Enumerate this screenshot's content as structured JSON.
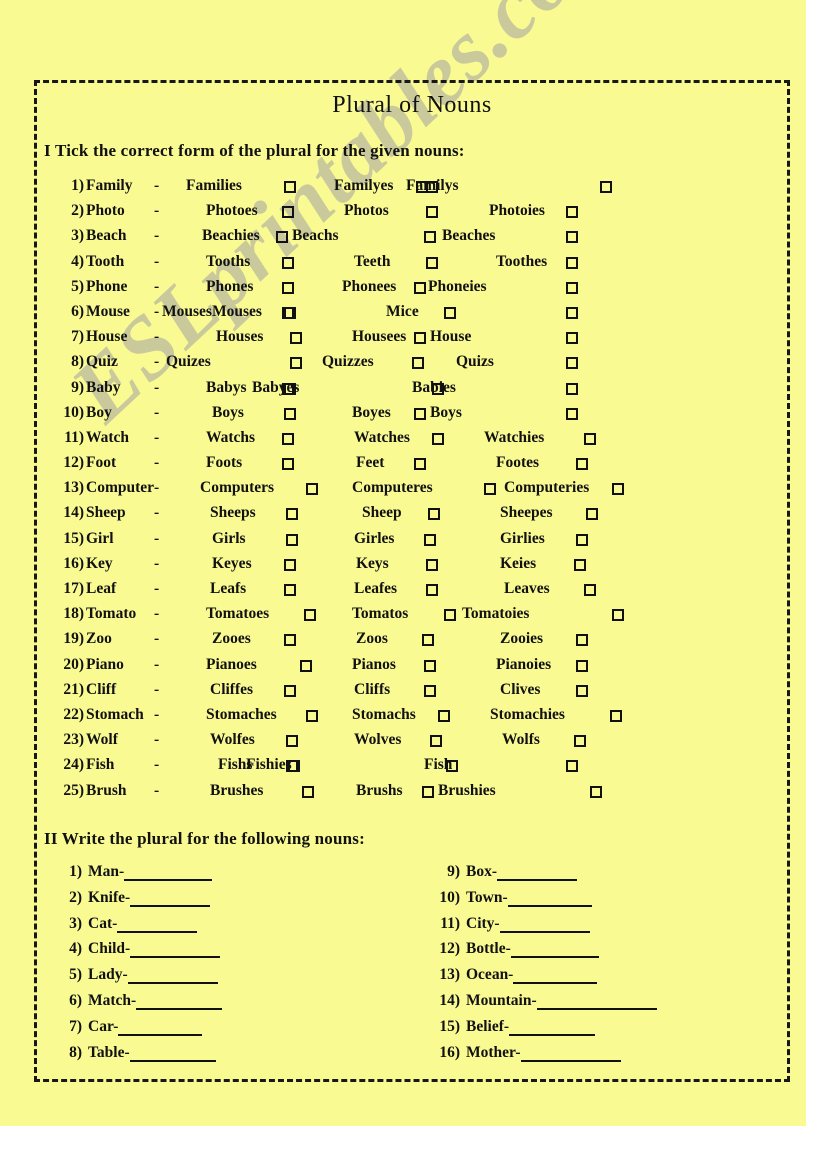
{
  "page": {
    "title": "Plural of Nouns",
    "background_color": "#fafa93",
    "ink_color": "#111111",
    "watermark": "ESLprintables.com",
    "watermark_color": "#c9c99c"
  },
  "section1": {
    "heading": "I Tick the correct form of the plural for the given nouns:",
    "rows": [
      {
        "num": "1)",
        "noun": "Family",
        "dash": "-",
        "opt1": "Families",
        "opt2": "Familyes",
        "opt3": "Familys",
        "opt4": ""
      },
      {
        "num": "2)",
        "noun": "Photo",
        "dash": "-",
        "opt1": "Photoes",
        "opt2": "Photos",
        "opt3": "Photoies",
        "opt4": ""
      },
      {
        "num": "3)",
        "noun": "Beach",
        "dash": "-",
        "opt1": "Beachies",
        "opt2": "Beachs",
        "opt3": "Beaches",
        "opt4": ""
      },
      {
        "num": "4)",
        "noun": "Tooth",
        "dash": "-",
        "opt1": "Tooths",
        "opt2": "Teeth",
        "opt3": "Toothes",
        "opt4": ""
      },
      {
        "num": "5)",
        "noun": "Phone",
        "dash": "-",
        "opt1": "Phones",
        "opt2": "Phonees",
        "opt3": "Phoneies",
        "opt4": ""
      },
      {
        "num": "6)",
        "noun": "Mouse",
        "dash": "-",
        "opt1": "Mouses",
        "opt2": "Mouses",
        "opt3": "Mice",
        "opt4": ""
      },
      {
        "num": "7)",
        "noun": "House",
        "dash": "-",
        "opt1": "Houses",
        "opt2": "Housees",
        "opt3": "House",
        "opt4": ""
      },
      {
        "num": "8)",
        "noun": "Quiz",
        "dash": "-",
        "opt1": "Quizes",
        "opt2": "Quizzes",
        "opt3": "Quizs",
        "opt4": ""
      },
      {
        "num": "9)",
        "noun": "Baby",
        "dash": "-",
        "opt1": "Babys",
        "opt2": "Babyes",
        "opt3": "Babies",
        "opt4": ""
      },
      {
        "num": "10)",
        "noun": "Boy",
        "dash": "-",
        "opt1": "Boys",
        "opt2": "Boyes",
        "opt3": "Boys",
        "opt4": ""
      },
      {
        "num": "11)",
        "noun": "Watch",
        "dash": "-",
        "opt1": "Watchs",
        "opt2": "Watches",
        "opt3": "Watchies",
        "opt4": ""
      },
      {
        "num": "12)",
        "noun": "Foot",
        "dash": "-",
        "opt1": "Foots",
        "opt2": "Feet",
        "opt3": "Footes",
        "opt4": ""
      },
      {
        "num": "13)",
        "noun": "Computer",
        "dash": "-",
        "opt1": "Computers",
        "opt2": "Computeres",
        "opt3": "Computeries",
        "opt4": ""
      },
      {
        "num": "14)",
        "noun": "Sheep",
        "dash": "-",
        "opt1": "Sheeps",
        "opt2": "Sheep",
        "opt3": "Sheepes",
        "opt4": ""
      },
      {
        "num": "15)",
        "noun": "Girl",
        "dash": "-",
        "opt1": "Girls",
        "opt2": "Girles",
        "opt3": "Girlies",
        "opt4": ""
      },
      {
        "num": "16)",
        "noun": "Key",
        "dash": "-",
        "opt1": "Keyes",
        "opt2": "Keys",
        "opt3": "Keies",
        "opt4": ""
      },
      {
        "num": "17)",
        "noun": "Leaf",
        "dash": "-",
        "opt1": "Leafs",
        "opt2": "Leafes",
        "opt3": "Leaves",
        "opt4": ""
      },
      {
        "num": "18)",
        "noun": "Tomato",
        "dash": "-",
        "opt1": "Tomatoes",
        "opt2": "Tomatos",
        "opt3": "Tomatoies",
        "opt4": ""
      },
      {
        "num": "19)",
        "noun": "Zoo",
        "dash": "-",
        "opt1": "Zooes",
        "opt2": "Zoos",
        "opt3": "Zooies",
        "opt4": ""
      },
      {
        "num": "20)",
        "noun": "Piano",
        "dash": "-",
        "opt1": "Pianoes",
        "opt2": "Pianos",
        "opt3": "Pianoies",
        "opt4": ""
      },
      {
        "num": "21)",
        "noun": "Cliff",
        "dash": "-",
        "opt1": "Cliffes",
        "opt2": "Cliffs",
        "opt3": "Clives",
        "opt4": ""
      },
      {
        "num": "22)",
        "noun": "Stomach",
        "dash": "-",
        "opt1": "Stomaches",
        "opt2": "Stomachs",
        "opt3": "Stomachies",
        "opt4": ""
      },
      {
        "num": "23)",
        "noun": "Wolf",
        "dash": "-",
        "opt1": "Wolfes",
        "opt2": "Wolves",
        "opt3": "Wolfs",
        "opt4": ""
      },
      {
        "num": "24)",
        "noun": "Fish",
        "dash": "-",
        "opt1": "Fishs",
        "opt2": "Fishies",
        "opt3": "Fish",
        "opt4": ""
      },
      {
        "num": "25)",
        "noun": "Brush",
        "dash": "-",
        "opt1": "Brushes",
        "opt2": "Brushs",
        "opt3": "Brushies",
        "opt4": ""
      }
    ]
  },
  "section2": {
    "heading": "II Write the plural for the following nouns:",
    "left_column": [
      {
        "num": "1)",
        "word": "Man-",
        "blank_width": 88
      },
      {
        "num": "2)",
        "word": "Knife-",
        "blank_width": 80
      },
      {
        "num": "3)",
        "word": "Cat-",
        "blank_width": 80
      },
      {
        "num": "4)",
        "word": "Child-",
        "blank_width": 90
      },
      {
        "num": "5)",
        "word": "Lady-",
        "blank_width": 90
      },
      {
        "num": "6)",
        "word": "Match-",
        "blank_width": 86
      },
      {
        "num": "7)",
        "word": "Car-",
        "blank_width": 84
      },
      {
        "num": "8)",
        "word": "Table-",
        "blank_width": 86
      }
    ],
    "right_column": [
      {
        "num": "9)",
        "word": "Box-",
        "blank_width": 80
      },
      {
        "num": "10)",
        "word": "Town-",
        "blank_width": 84
      },
      {
        "num": "11)",
        "word": "City-",
        "blank_width": 90
      },
      {
        "num": "12)",
        "word": "Bottle-",
        "blank_width": 88
      },
      {
        "num": "13)",
        "word": "Ocean-",
        "blank_width": 84
      },
      {
        "num": "14)",
        "word": "Mountain-",
        "blank_width": 120
      },
      {
        "num": "15)",
        "word": "Belief-",
        "blank_width": 86
      },
      {
        "num": "16)",
        "word": "Mother-",
        "blank_width": 100
      }
    ]
  }
}
